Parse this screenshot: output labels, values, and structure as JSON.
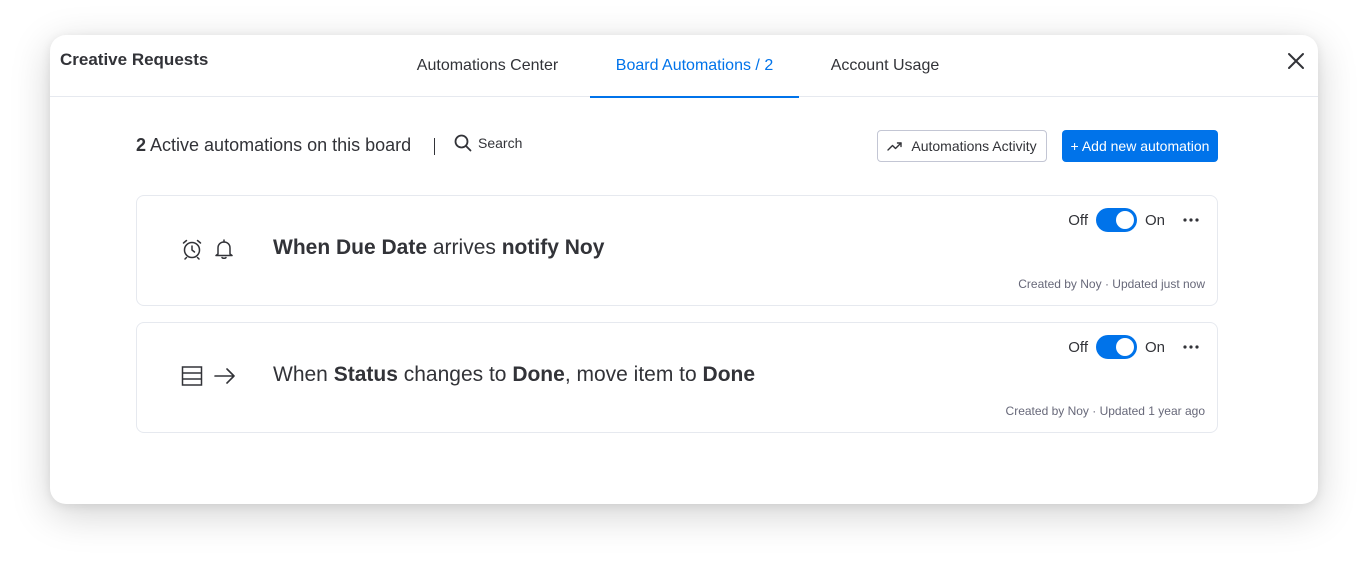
{
  "header": {
    "board_title": "Creative Requests",
    "tabs": [
      {
        "label": "Automations Center",
        "active": false
      },
      {
        "label": "Board Automations / 2",
        "active": true
      },
      {
        "label": "Account Usage",
        "active": false
      }
    ],
    "close_icon": "close-icon"
  },
  "toolbar": {
    "active_count": "2",
    "active_label": "Active automations on this board",
    "search_label": "Search",
    "activity_label": "Automations Activity",
    "add_label": "+ Add new automation"
  },
  "automations": [
    {
      "icons": [
        "alarm-clock-icon",
        "bell-icon"
      ],
      "recipe": [
        {
          "text": "When ",
          "bold": true
        },
        {
          "text": "Due Date",
          "bold": true
        },
        {
          "text": " arrives ",
          "bold": false
        },
        {
          "text": "notify Noy",
          "bold": true
        }
      ],
      "off_label": "Off",
      "on_label": "On",
      "enabled": true,
      "meta": "Created by Noy · Updated just now"
    },
    {
      "icons": [
        "status-column-icon",
        "arrow-right-icon"
      ],
      "recipe": [
        {
          "text": "When ",
          "bold": false
        },
        {
          "text": "Status",
          "bold": true
        },
        {
          "text": " changes to ",
          "bold": false
        },
        {
          "text": "Done",
          "bold": true
        },
        {
          "text": ", move item to ",
          "bold": false
        },
        {
          "text": "Done",
          "bold": true
        }
      ],
      "off_label": "Off",
      "on_label": "On",
      "enabled": true,
      "meta": "Created by Noy · Updated 1 year ago"
    }
  ],
  "colors": {
    "accent": "#0073ea",
    "text": "#323338",
    "muted": "#676879",
    "border": "#e6e9ef"
  }
}
